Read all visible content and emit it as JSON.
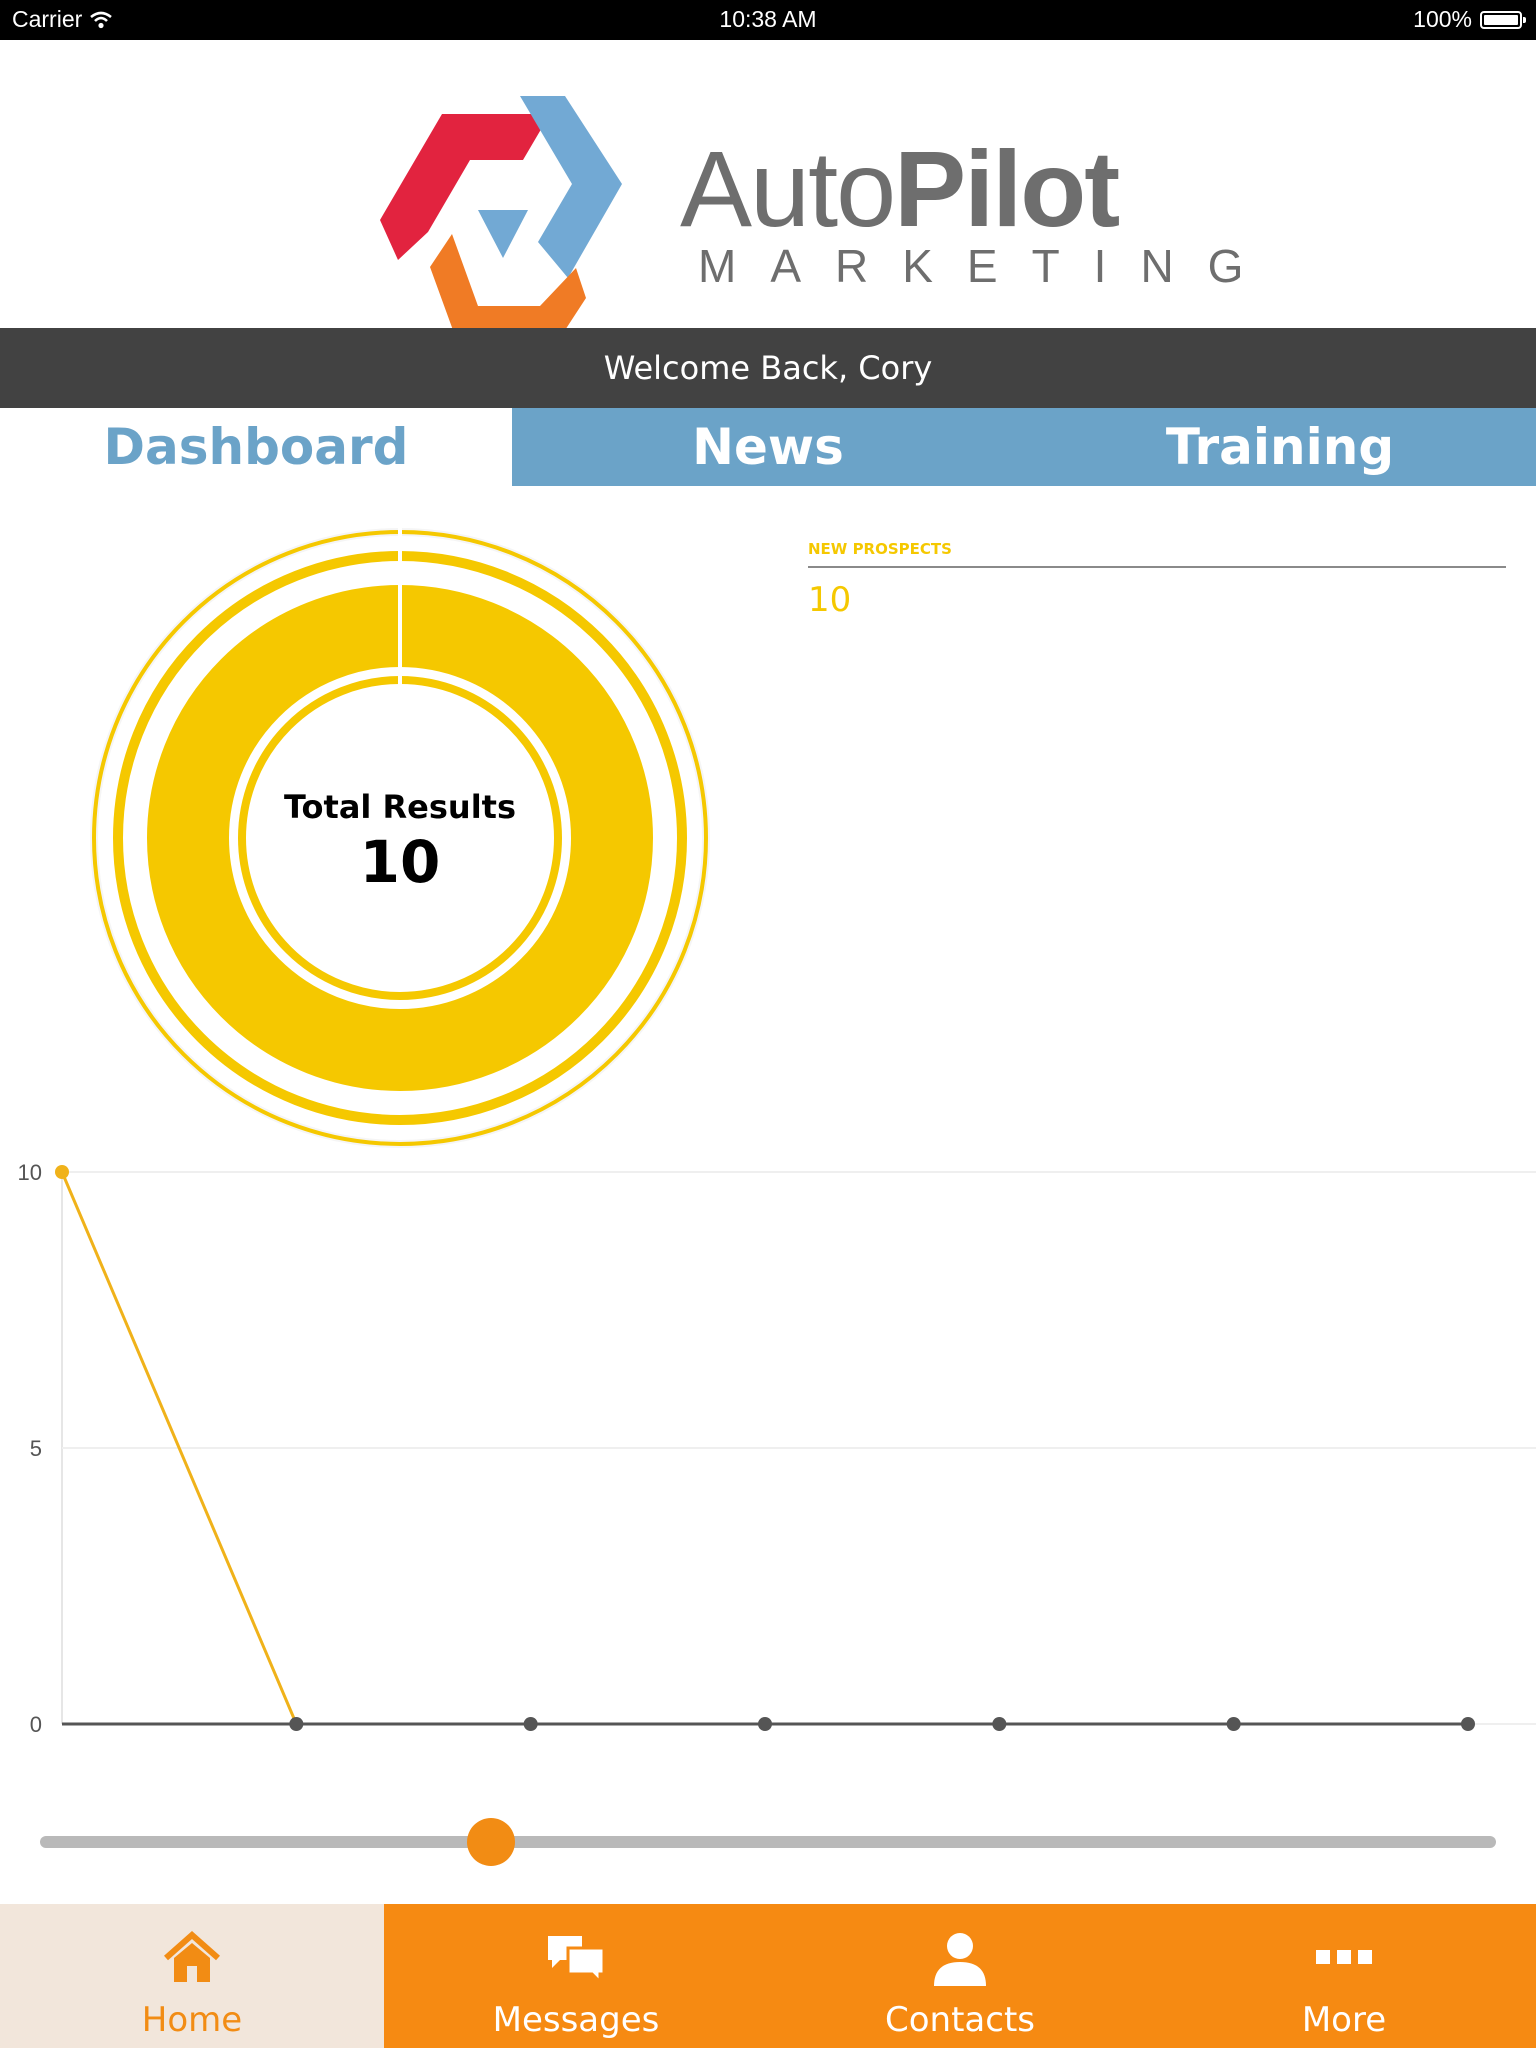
{
  "status_bar": {
    "carrier": "Carrier",
    "time": "10:38 AM",
    "battery": "100%"
  },
  "brand": {
    "name_regular": "Auto",
    "name_bold": "Pilot",
    "subtitle": "MARKETING",
    "colors": {
      "red": "#e2233f",
      "blue": "#72a9d4",
      "orange": "#f07b25",
      "text": "#6e6e6e"
    }
  },
  "welcome": "Welcome Back, Cory",
  "tabs": [
    {
      "label": "Dashboard",
      "active": true
    },
    {
      "label": "News",
      "active": false
    },
    {
      "label": "Training",
      "active": false
    }
  ],
  "summary": {
    "label": "Total Results",
    "value": "10"
  },
  "prospects": {
    "label": "NEW PROSPECTS",
    "value": "10"
  },
  "chart_data": {
    "type": "line",
    "x": [
      1,
      2,
      3,
      4,
      5,
      6,
      7
    ],
    "series": [
      {
        "values": [
          10,
          0,
          0,
          0,
          0,
          0,
          0
        ],
        "color": "#f0b21a"
      }
    ],
    "yticks": [
      "0",
      "5",
      "10"
    ],
    "ylim": [
      0,
      10
    ],
    "grid": true
  },
  "slider": {
    "position": 0.31
  },
  "tab_bar": [
    {
      "label": "Home",
      "icon": "home-icon",
      "active": true
    },
    {
      "label": "Messages",
      "icon": "messages-icon",
      "active": false
    },
    {
      "label": "Contacts",
      "icon": "contacts-icon",
      "active": false
    },
    {
      "label": "More",
      "icon": "more-icon",
      "active": false
    }
  ],
  "colors": {
    "accent_blue": "#6ba3c8",
    "accent_yellow": "#f5c800",
    "accent_orange": "#f68a12",
    "header_dark": "#424242"
  }
}
